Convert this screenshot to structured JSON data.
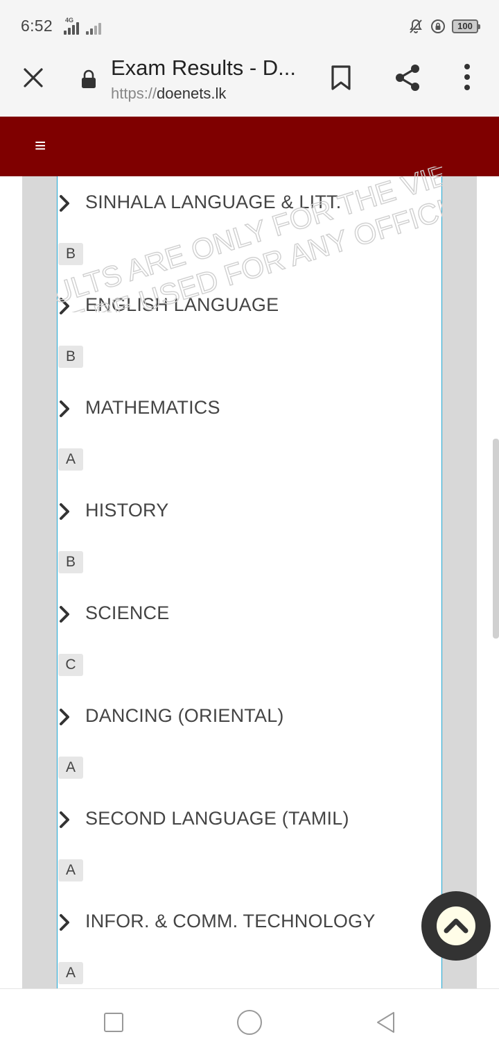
{
  "status_bar": {
    "time": "6:52",
    "network": "4G",
    "battery": "100",
    "icons": [
      "signal-icon",
      "silent-bell-icon",
      "rotation-lock-icon",
      "battery-icon"
    ]
  },
  "browser": {
    "title": "Exam Results - D...",
    "url_scheme": "https://",
    "url_host": "doenets.lk",
    "icons": [
      "close-icon",
      "lock-icon",
      "bookmark-icon",
      "share-icon",
      "more-vert-icon"
    ]
  },
  "site_header": {
    "menu_icon": "≡",
    "background": "#7f0000"
  },
  "watermark": {
    "line1": "ULTS ARE ONLY FOR THE VIEWI",
    "line2": "T BE USED FOR ANY OFFICIAL"
  },
  "results": [
    {
      "subject": "SINHALA LANGUAGE & LITT.",
      "grade": "B"
    },
    {
      "subject": "ENGLISH LANGUAGE",
      "grade": "B"
    },
    {
      "subject": "MATHEMATICS",
      "grade": "A"
    },
    {
      "subject": "HISTORY",
      "grade": "B"
    },
    {
      "subject": "SCIENCE",
      "grade": "C"
    },
    {
      "subject": "DANCING (ORIENTAL)",
      "grade": "A"
    },
    {
      "subject": "SECOND LANGUAGE (TAMIL)",
      "grade": "A"
    },
    {
      "subject": "INFOR. & COMM. TECHNOLOGY",
      "grade": "A"
    }
  ],
  "colors": {
    "panel_border": "#1ea7d4",
    "side_gutter": "#d8d8d8",
    "grade_badge": "#e6e6e6"
  },
  "scroll_top_button": {
    "icon": "chevron-up-icon"
  },
  "nav_bar": {
    "icons": [
      "recents-icon",
      "home-icon",
      "back-icon"
    ]
  }
}
